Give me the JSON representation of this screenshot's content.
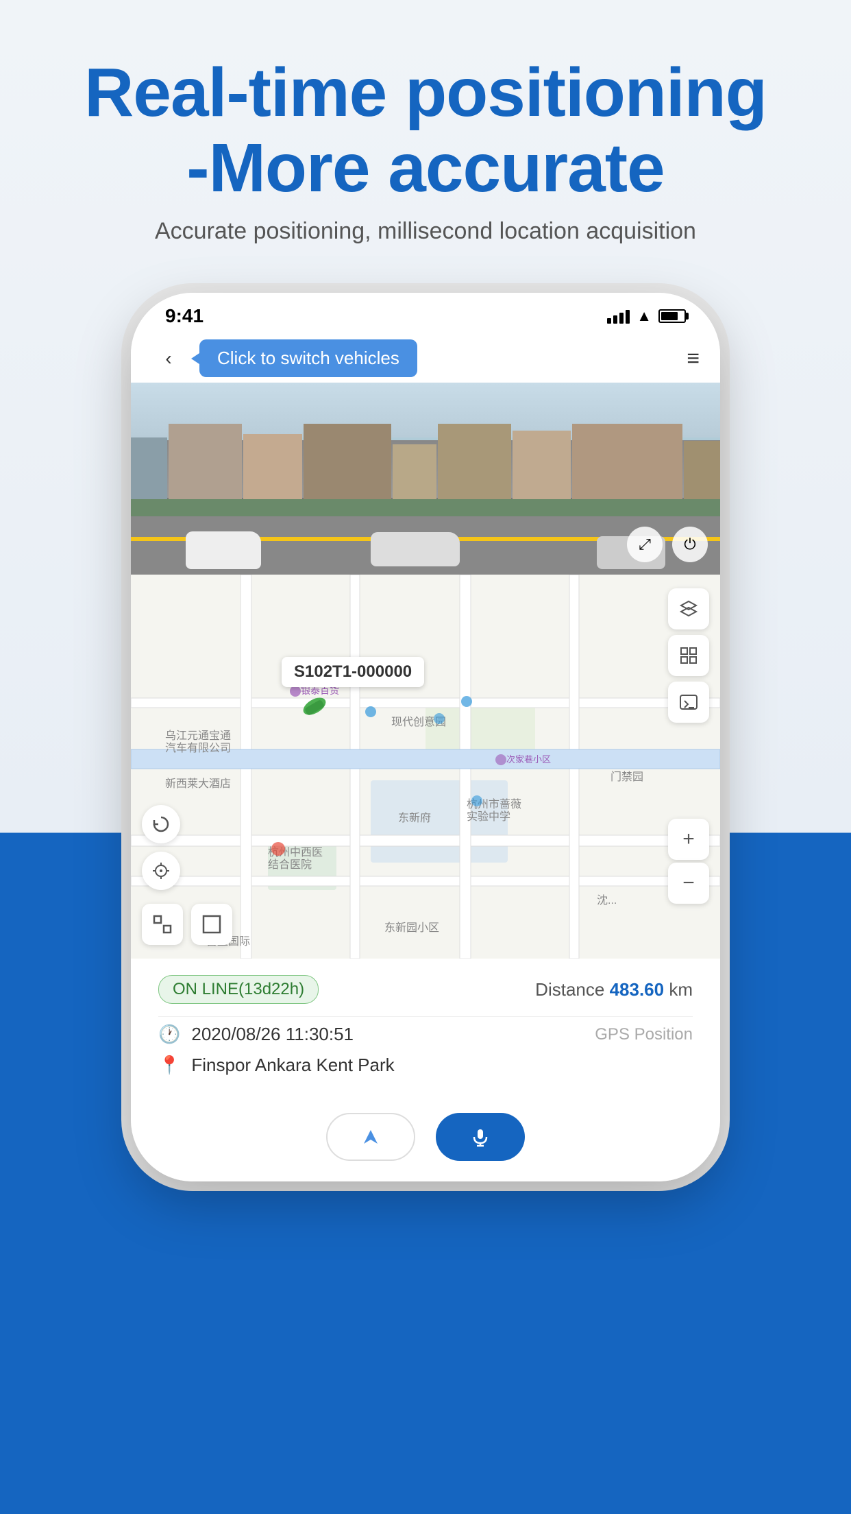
{
  "header": {
    "title_line1": "Real-time positioning",
    "title_line2": "-More accurate",
    "subtitle": "Accurate positioning, millisecond location acquisition"
  },
  "phone": {
    "status_bar": {
      "time": "9:41",
      "signal_bars": [
        8,
        12,
        16,
        20
      ],
      "wifi": "WiFi",
      "battery_pct": 75
    },
    "nav": {
      "back_label": "‹",
      "tooltip": "Click to switch vehicles",
      "menu_label": "≡"
    },
    "street_view": {
      "expand_icon": "⤢",
      "power_icon": "⏻"
    },
    "map": {
      "vehicle_id": "S102T1-000000",
      "layers_icon": "◈",
      "grid_icon": "⊞",
      "terminal_icon": ">_",
      "refresh_icon": "↺",
      "location_icon": "◎",
      "frame1_icon": "⊡",
      "frame2_icon": "⊟",
      "zoom_in": "+",
      "zoom_out": "−"
    },
    "info_panel": {
      "status": "ON LINE(13d22h)",
      "distance_label": "Distance",
      "distance_value": "483.60",
      "distance_unit": "km",
      "datetime": "2020/08/26 11:30:51",
      "position_type": "GPS Position",
      "location": "Finspor Ankara Kent Park",
      "clock_icon": "🕐",
      "pin_icon": "📍"
    },
    "action_buttons": {
      "navigate_icon": "➤",
      "mic_icon": "🎤"
    }
  }
}
